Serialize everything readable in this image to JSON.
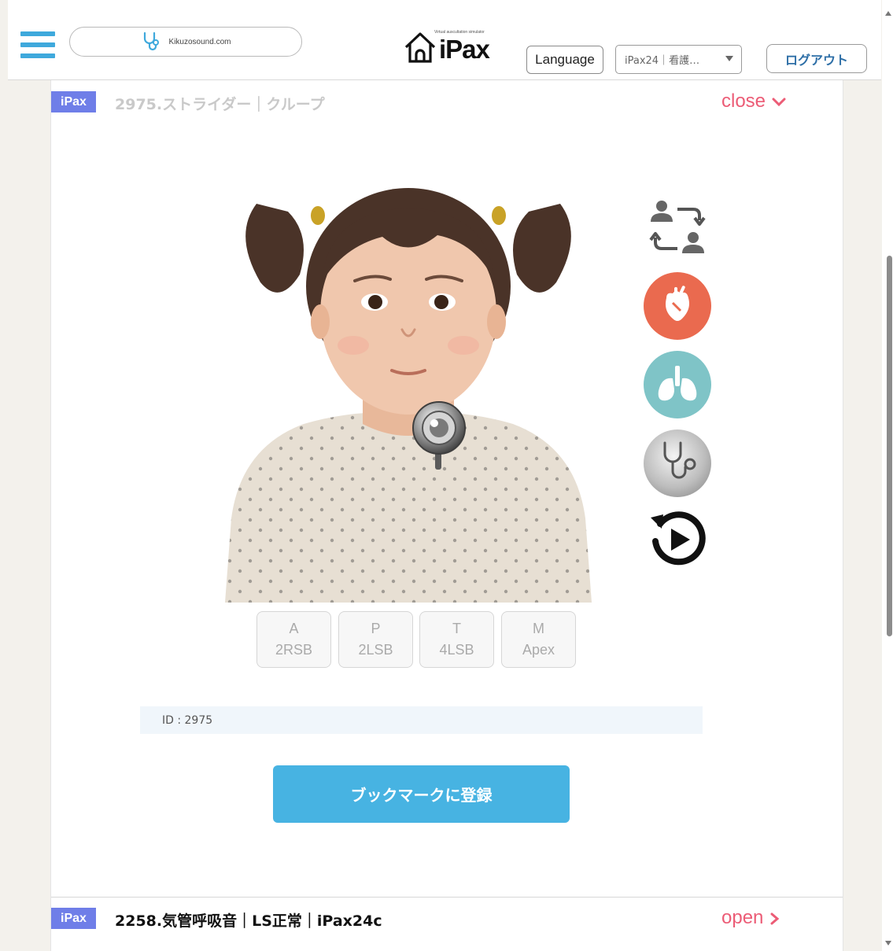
{
  "header": {
    "site_label": "Kikuzosound.com",
    "logo_tagline": "Virtual auscultation simulator",
    "logo_text": "iPax",
    "language_label": "Language",
    "select_value": "iPax24｜看護…",
    "logout_label": "ログアウト"
  },
  "open_item": {
    "badge": "iPax",
    "title": "2975.ストライダー｜クループ",
    "toggle_label": "close"
  },
  "positions": [
    {
      "letter": "A",
      "label": "2RSB"
    },
    {
      "letter": "P",
      "label": "2LSB"
    },
    {
      "letter": "T",
      "label": "4LSB"
    },
    {
      "letter": "M",
      "label": "Apex"
    }
  ],
  "id_text": "ID : 2975",
  "bookmark_label": "ブックマークに登録",
  "next_item": {
    "badge": "iPax",
    "title": "2258.気管呼吸音｜LS正常｜iPax24c",
    "toggle_label": "open"
  },
  "icons": {
    "switch": "switch-patient-icon",
    "heart": "heart-icon",
    "lungs": "lungs-icon",
    "stethoscope": "stethoscope-icon",
    "replay": "replay-icon"
  },
  "colors": {
    "accent_blue": "#47b3e2",
    "hamburger": "#3fa9dc",
    "badge": "#6f7ee8",
    "toggle": "#ec5c76",
    "heart": "#ea6a4f",
    "lungs": "#7fc4c7",
    "logout_text": "#2e6fa7"
  }
}
